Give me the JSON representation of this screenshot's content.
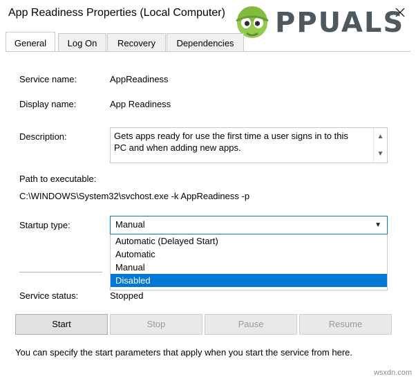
{
  "window": {
    "title": "App Readiness Properties (Local Computer)",
    "close_icon": "close-icon"
  },
  "watermark": {
    "text": "PPUALS",
    "full_text": "APPUALS"
  },
  "tabs": [
    {
      "label": "General",
      "selected": true
    },
    {
      "label": "Log On",
      "selected": false
    },
    {
      "label": "Recovery",
      "selected": false
    },
    {
      "label": "Dependencies",
      "selected": false
    }
  ],
  "general": {
    "service_name_label": "Service name:",
    "service_name_value": "AppReadiness",
    "display_name_label": "Display name:",
    "display_name_value": "App Readiness",
    "description_label": "Description:",
    "description_value": "Gets apps ready for use the first time a user signs in to this PC and when adding new apps.",
    "path_label": "Path to executable:",
    "path_value": "C:\\WINDOWS\\System32\\svchost.exe -k AppReadiness -p",
    "startup_type_label": "Startup type:",
    "startup_type_value": "Manual",
    "startup_type_options": [
      "Automatic (Delayed Start)",
      "Automatic",
      "Manual",
      "Disabled"
    ],
    "startup_type_highlighted": "Disabled",
    "service_status_label": "Service status:",
    "service_status_value": "Stopped"
  },
  "buttons": [
    {
      "label": "Start",
      "enabled": true
    },
    {
      "label": "Stop",
      "enabled": false
    },
    {
      "label": "Pause",
      "enabled": false
    },
    {
      "label": "Resume",
      "enabled": false
    }
  ],
  "footer": {
    "text": "You can specify the start parameters that apply when you start the service from here.",
    "site_tag": "wsxdn.com"
  },
  "colors": {
    "accent": "#0078d7",
    "window_bg": "#ffffff",
    "button_face": "#e1e1e1",
    "watermark": "#3f4a52"
  }
}
